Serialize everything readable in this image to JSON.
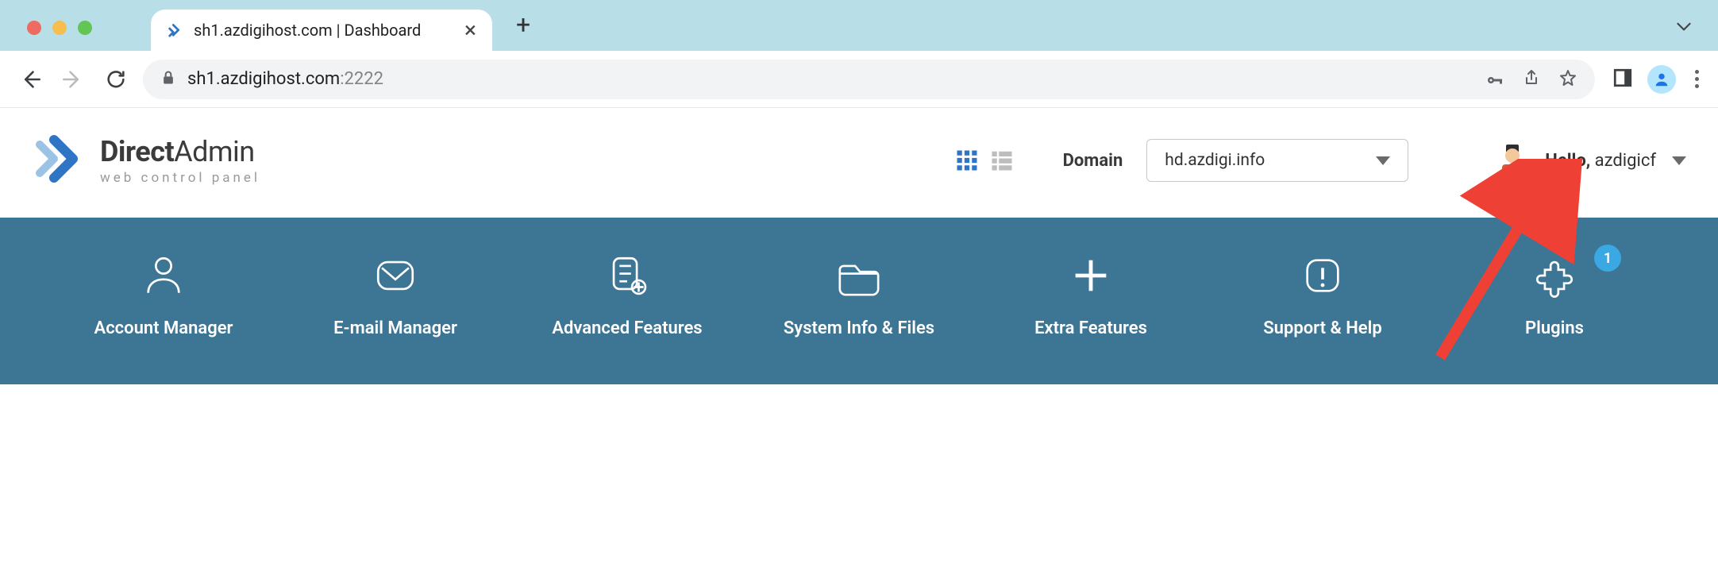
{
  "browser": {
    "tab_title": "sh1.azdigihost.com | Dashboard",
    "url_host": "sh1.azdigihost.com",
    "url_port": ":2222"
  },
  "header": {
    "brand_bold": "Direct",
    "brand_light": "Admin",
    "subtitle": "web control panel",
    "domain_label": "Domain",
    "domain_selected": "hd.azdigi.info",
    "hello_prefix": "Hello, ",
    "username": "azdigicf"
  },
  "nav": {
    "items": [
      {
        "label": "Account Manager"
      },
      {
        "label": "E-mail Manager"
      },
      {
        "label": "Advanced Features"
      },
      {
        "label": "System Info & Files"
      },
      {
        "label": "Extra Features"
      },
      {
        "label": "Support & Help"
      },
      {
        "label": "Plugins",
        "badge": "1"
      }
    ]
  }
}
